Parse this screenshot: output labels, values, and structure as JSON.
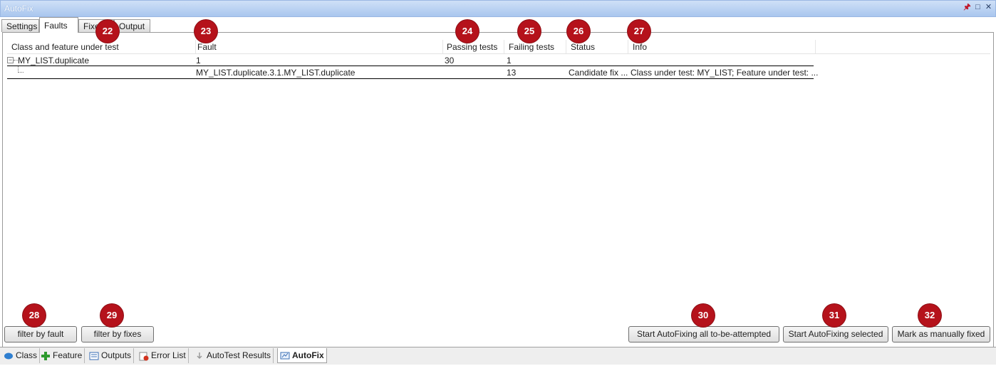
{
  "window": {
    "title": "AutoFix"
  },
  "tabs": [
    {
      "label": "Settings"
    },
    {
      "label": "Faults"
    },
    {
      "label": "Fixes"
    },
    {
      "label": "Output"
    }
  ],
  "grid": {
    "columns": [
      "Class and feature under test",
      "Fault",
      "Passing tests",
      "Failing tests",
      "Status",
      "Info"
    ],
    "rows": [
      {
        "class_feature": "MY_LIST.duplicate",
        "fault": "1",
        "passing": "30",
        "failing": "1",
        "status": "",
        "info": ""
      },
      {
        "class_feature": "",
        "fault": "MY_LIST.duplicate.3.1.MY_LIST.duplicate",
        "passing": "",
        "failing": "13",
        "status": "Candidate fix ...",
        "info": "Class under test: MY_LIST; Feature under test: ..."
      }
    ]
  },
  "buttons": {
    "filter_fault": "filter by fault",
    "filter_fixes": "filter by fixes",
    "start_all": "Start AutoFixing all to-be-attempted",
    "start_selected": "Start AutoFixing selected",
    "mark_fixed": "Mark as manually fixed"
  },
  "bottom_tabs": [
    {
      "label": "Class",
      "icon": "class-icon"
    },
    {
      "label": "Feature",
      "icon": "feature-icon"
    },
    {
      "label": "Outputs",
      "icon": "outputs-icon"
    },
    {
      "label": "Error List",
      "icon": "error-list-icon"
    },
    {
      "label": "AutoTest Results",
      "icon": "autotest-icon"
    },
    {
      "label": "AutoFix",
      "icon": "autofix-icon"
    }
  ],
  "badges": [
    "22",
    "23",
    "24",
    "25",
    "26",
    "27",
    "28",
    "29",
    "30",
    "31",
    "32"
  ],
  "colors": {
    "badge": "#b5121b",
    "titlebar": "#a9c6ee"
  }
}
